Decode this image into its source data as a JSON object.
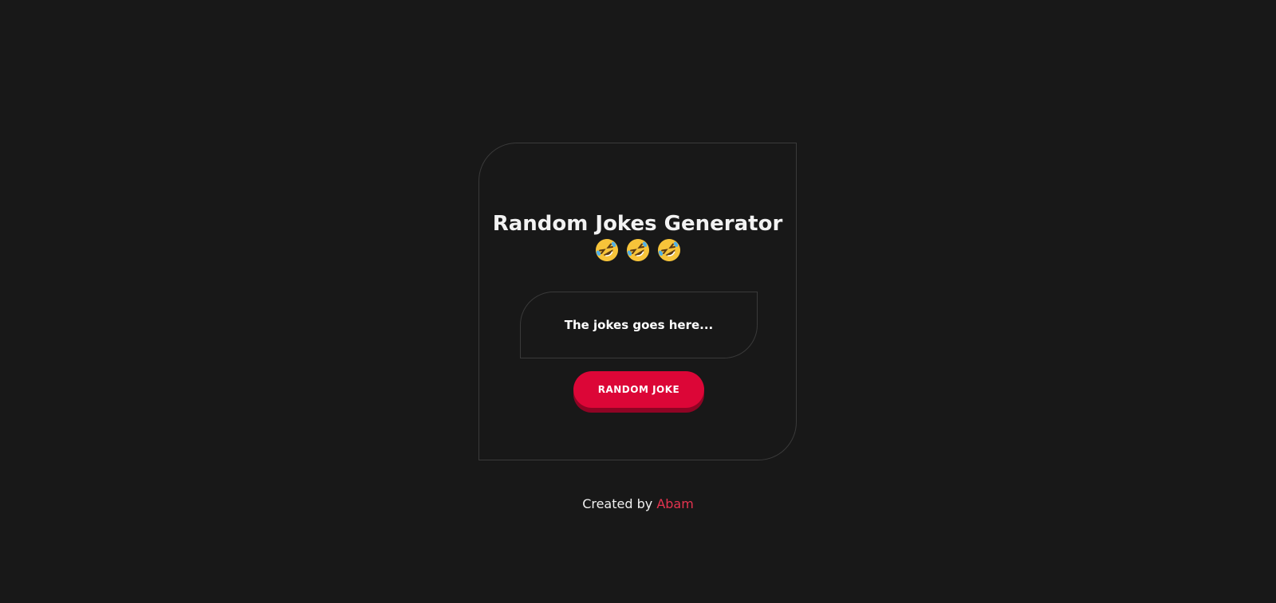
{
  "card": {
    "title": "Random Jokes Generator",
    "emojis": [
      "rolling-on-floor-laughing-icon",
      "rolling-on-floor-laughing-icon",
      "rolling-on-floor-laughing-icon"
    ],
    "joke_text": "The jokes goes here...",
    "button_label": "RANDOM JOKE"
  },
  "footer": {
    "prefix": "Created by",
    "author": "Abam"
  },
  "colors": {
    "background": "#181818",
    "accent": "#dc0637",
    "accent_shadow": "#8f0424",
    "link": "#e5334f",
    "border": "#3a3a3a"
  }
}
